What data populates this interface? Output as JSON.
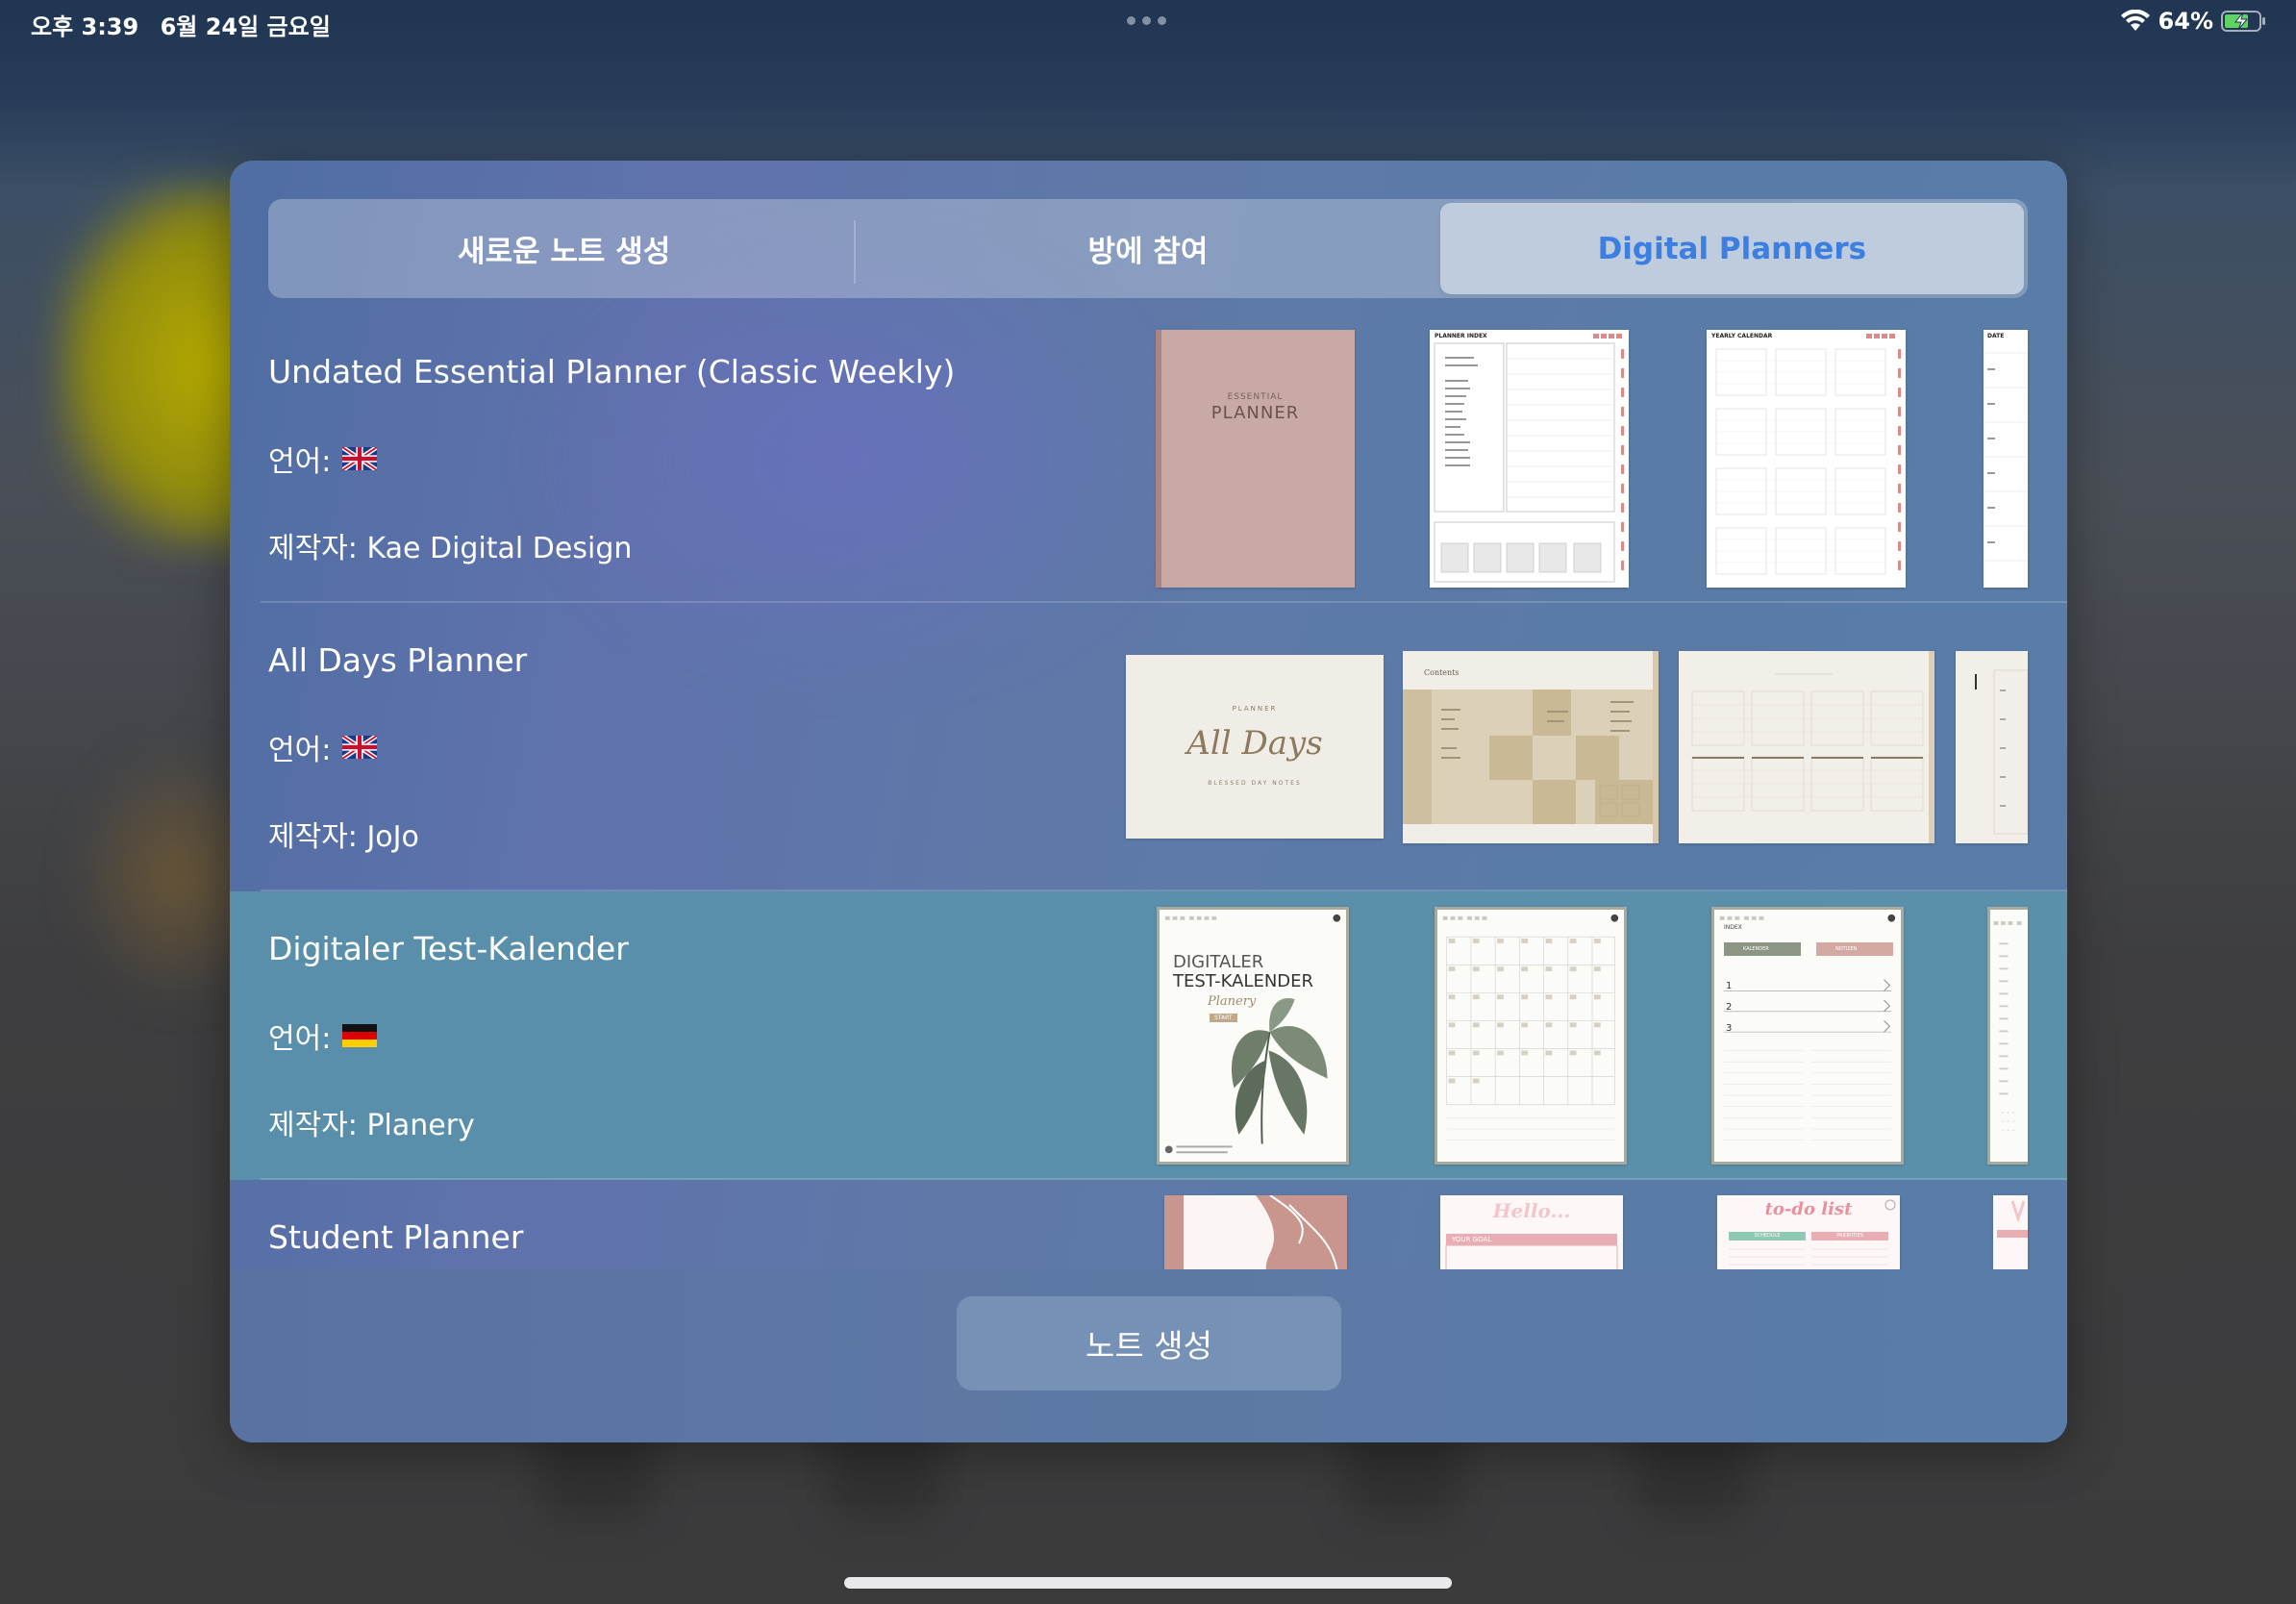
{
  "status_bar": {
    "time": "오후 3:39",
    "date": "6월 24일 금요일",
    "battery": "64%"
  },
  "tabs": [
    {
      "label": "새로운 노트 생성",
      "active": false
    },
    {
      "label": "방에 참여",
      "active": false
    },
    {
      "label": "Digital Planners",
      "active": true
    }
  ],
  "planners": [
    {
      "title": "Undated Essential Planner (Classic Weekly)",
      "language_label": "언어:",
      "flag": "uk-flag-icon",
      "author_label": "제작자: Kae Digital Design",
      "cover_small": "ESSENTIAL",
      "cover_big": "PLANNER",
      "page2_title": "PLANNER INDEX",
      "page3_title": "YEARLY CALENDAR",
      "page4_title": "DATE"
    },
    {
      "title": "All Days Planner",
      "language_label": "언어:",
      "flag": "uk-flag-icon",
      "author_label": "제작자: JoJo",
      "cover_small": "PLANNER",
      "cover_big": "All Days",
      "cover_sub": "BLESSED DAY NOTES",
      "page2_title": "Contents"
    },
    {
      "title": "Digitaler Test-Kalender",
      "language_label": "언어:",
      "flag": "de-flag-icon",
      "author_label": "제작자: Planery",
      "cover_small": "DIGITALER",
      "cover_big": "TEST-KALENDER",
      "cover_brand": "Planery",
      "cover_button": "START",
      "page3_title": "INDEX",
      "page3_tab1": "KALENDER",
      "page3_tab2": "NOTIZEN",
      "page3_items": [
        "1",
        "2",
        "3"
      ]
    },
    {
      "title": "Student Planner",
      "page2_title": "Hello...",
      "page2_sub": "YOUR GOAL",
      "page3_title": "to-do list",
      "page3_col1": "SCHEDULE",
      "page3_col2": "PRIORITIES"
    }
  ],
  "footer": {
    "create_label": "노트 생성"
  },
  "colors": {
    "accent": "#3d7fe0",
    "modal": "#5b7ba7"
  }
}
